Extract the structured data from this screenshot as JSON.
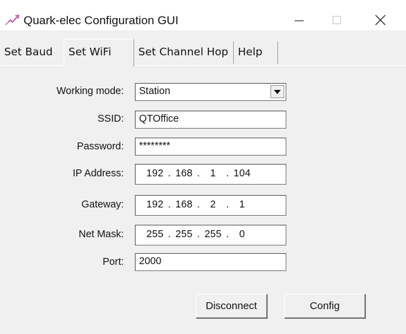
{
  "window": {
    "title": "Quark-elec Configuration GUI",
    "controls": {
      "minimize": "minimize-icon",
      "maximize": "maximize-icon",
      "close": "close-icon"
    }
  },
  "tabs": [
    {
      "label": "Set Baud",
      "active": false
    },
    {
      "label": "Set WiFi",
      "active": true
    },
    {
      "label": "Set Channel Hop",
      "active": false
    },
    {
      "label": "Help",
      "active": false
    }
  ],
  "form": {
    "working_mode": {
      "label": "Working mode:",
      "value": "Station"
    },
    "ssid": {
      "label": "SSID:",
      "value": "QTOffice"
    },
    "password": {
      "label": "Password:",
      "value": "********"
    },
    "ip_address": {
      "label": "IP Address:",
      "octets": [
        "192",
        "168",
        "1",
        "104"
      ]
    },
    "gateway": {
      "label": "Gateway:",
      "octets": [
        "192",
        "168",
        "2",
        "1"
      ]
    },
    "net_mask": {
      "label": "Net Mask:",
      "octets": [
        "255",
        "255",
        "255",
        "0"
      ]
    },
    "port": {
      "label": "Port:",
      "value": "2000"
    }
  },
  "buttons": {
    "disconnect": "Disconnect",
    "config": "Config"
  },
  "ip_separator": "."
}
